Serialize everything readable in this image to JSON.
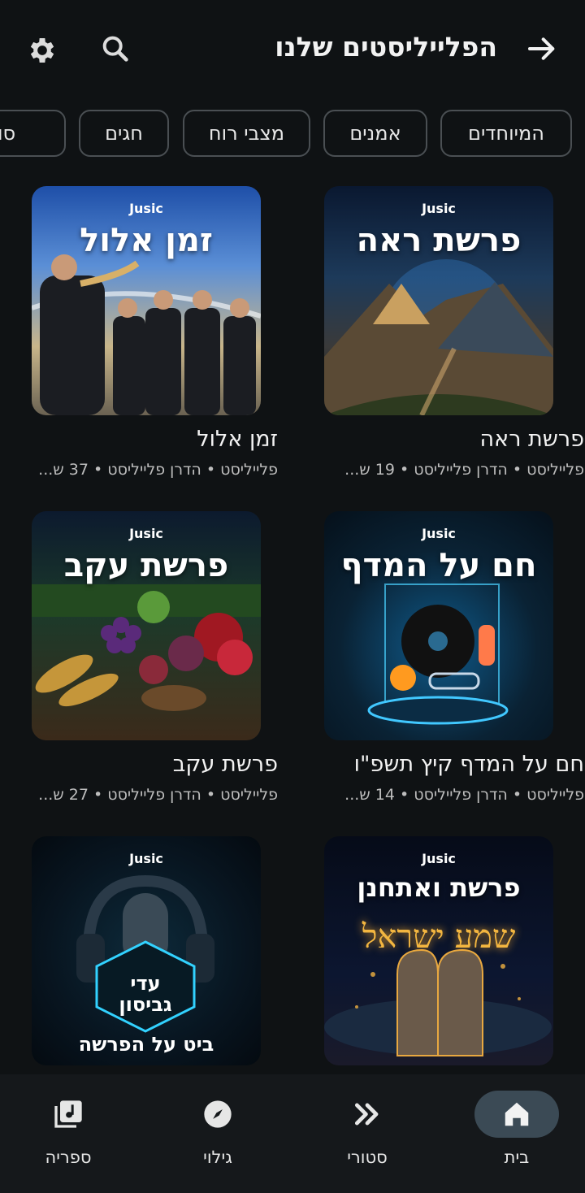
{
  "header": {
    "title": "הפלייליסטים שלנו"
  },
  "chips": [
    "המיוחדים",
    "אמנים",
    "מצבי רוח",
    "חגים",
    "סופ"
  ],
  "cards": [
    {
      "title": "פרשת ראה",
      "subtitle": "פלייליסט • הדרן פלייליסט • 19 ש...",
      "cover_brand": "Jusic",
      "cover_text": "פרשת ראה"
    },
    {
      "title": "זמן אלול",
      "subtitle": "פלייליסט • הדרן פלייליסט • 37 ש...",
      "cover_brand": "Jusic",
      "cover_text": "זמן אלול"
    },
    {
      "title": "חם על המדף קיץ תשפ\"ו",
      "subtitle": "פלייליסט • הדרן פלייליסט • 14 ש...",
      "cover_brand": "Jusic",
      "cover_text": "חם על המדף"
    },
    {
      "title": "פרשת עקב",
      "subtitle": "פלייליסט • הדרן פלייליסט • 27 ש...",
      "cover_brand": "Jusic",
      "cover_text": "פרשת עקב"
    },
    {
      "title": "",
      "subtitle": "",
      "cover_brand": "Jusic",
      "cover_text": "פרשת ואתחנן",
      "cover_extra": "שמע ישראל"
    },
    {
      "title": "",
      "subtitle": "",
      "cover_brand": "Jusic",
      "cover_text": "עדי גביסון",
      "cover_extra": "ביט על הפרשה"
    }
  ],
  "nav": [
    {
      "label": "בית",
      "icon": "home-icon",
      "active": true
    },
    {
      "label": "סטורי",
      "icon": "story-icon"
    },
    {
      "label": "גילוי",
      "icon": "compass-icon"
    },
    {
      "label": "ספריה",
      "icon": "library-icon"
    }
  ]
}
